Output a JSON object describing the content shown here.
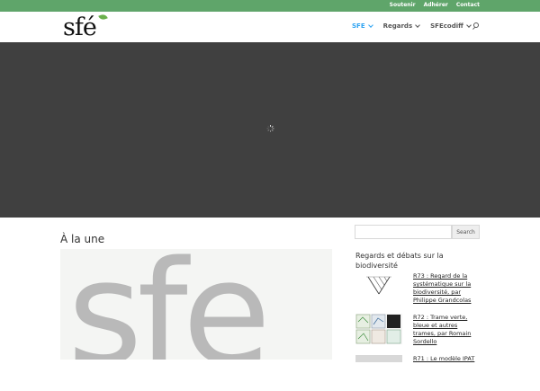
{
  "topbar": {
    "links": [
      "Soutenir",
      "Adhérer",
      "Contact"
    ],
    "color": "#5fa56a"
  },
  "logo": {
    "text": "sfé"
  },
  "nav": {
    "items": [
      {
        "label": "SFE",
        "active": true
      },
      {
        "label": "Regards",
        "active": false
      },
      {
        "label": "SFEcodiff",
        "active": false
      }
    ],
    "active_color": "#2ea3f2"
  },
  "hero": {
    "background": "#404040",
    "state": "loading"
  },
  "main": {
    "section_title": "À la une",
    "featured_text": "sfe"
  },
  "sidebar": {
    "search": {
      "value": "",
      "button_label": "Search"
    },
    "widget_title": "Regards et débats sur la biodiversité",
    "posts": [
      {
        "title": "R73 : Regard de la systématique sur la biodiversité, par Philippe Grandcolas"
      },
      {
        "title": "R72 : Trame verte, bleue et autres trames, par Romain Sordello"
      },
      {
        "title": "R71 : Le modèle IPAT"
      }
    ]
  }
}
